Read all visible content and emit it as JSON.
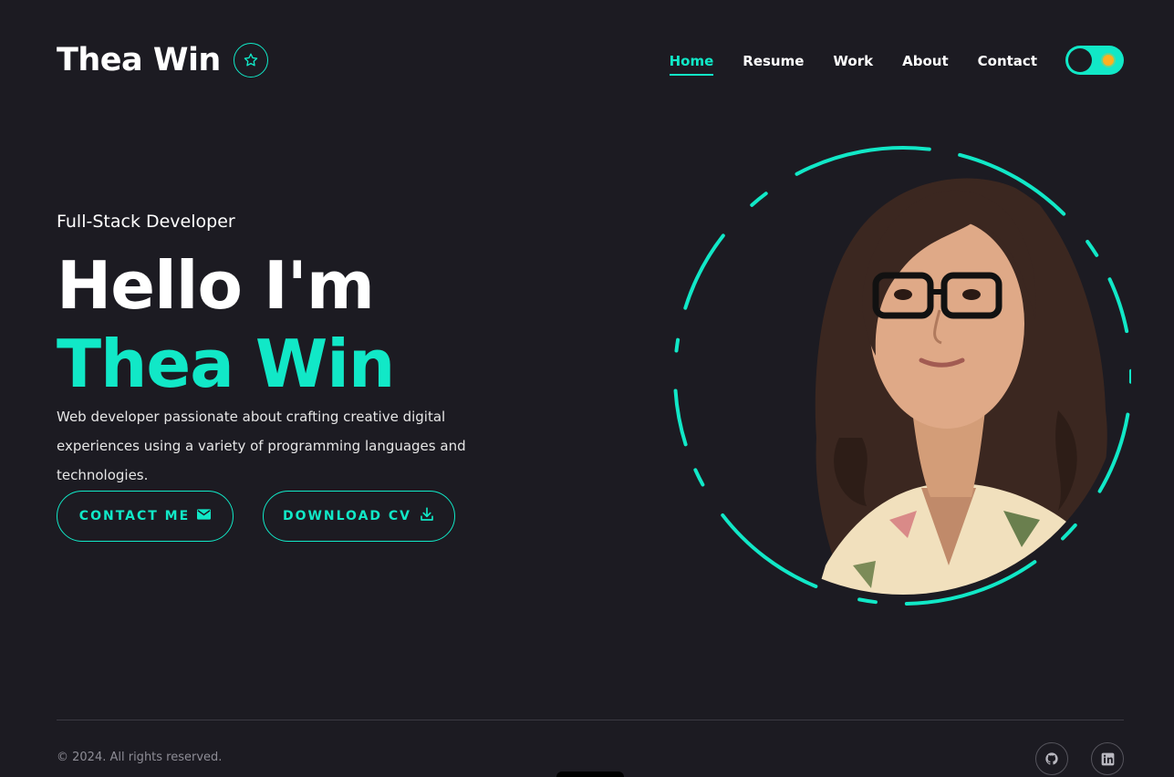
{
  "brand": {
    "name": "Thea Win",
    "badge_icon": "star-icon"
  },
  "nav": {
    "items": [
      {
        "label": "Home",
        "active": true
      },
      {
        "label": "Resume",
        "active": false
      },
      {
        "label": "Work",
        "active": false
      },
      {
        "label": "About",
        "active": false
      },
      {
        "label": "Contact",
        "active": false
      }
    ],
    "theme_toggle": {
      "state": "dark"
    }
  },
  "hero": {
    "subtitle": "Full-Stack Developer",
    "greeting": "Hello I'm",
    "name": "Thea Win",
    "description": "Web developer passionate about crafting creative digital experiences using a variety of programming languages and technologies.",
    "buttons": {
      "contact_label": "CONTACT ME",
      "contact_icon": "envelope-icon",
      "cv_label": "DOWNLOAD CV",
      "cv_icon": "download-icon"
    }
  },
  "footer": {
    "copyright": "© 2024. All rights reserved.",
    "socials": [
      {
        "icon": "github-icon"
      },
      {
        "icon": "linkedin-icon"
      }
    ]
  },
  "colors": {
    "accent": "#11e8c7",
    "background": "#1c1b22",
    "text": "#ffffff",
    "muted": "#8d8c95"
  }
}
